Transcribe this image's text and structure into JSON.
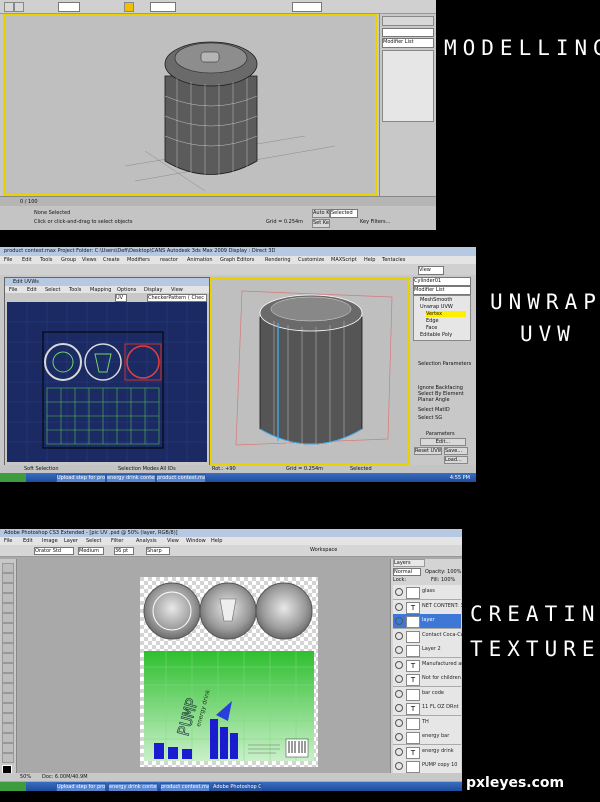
{
  "captions": {
    "modelling": "MODELLING",
    "unwrap_line1": "UNWRAP",
    "unwrap_line2": "UVW",
    "creating_line1": "CREATING",
    "creating_line2": "TEXTURE"
  },
  "watermark": "pxleyes.com",
  "panel1": {
    "modifier_list": "Modifier List",
    "timeline": "0 / 100",
    "status_selected": "None Selected",
    "status_prompt": "Click or click-and-drag to select objects",
    "grid": "Grid = 0.254m",
    "auto_key": "Auto Key",
    "selected": "Selected",
    "set_key": "Set Key",
    "key_filters": "Key Filters...",
    "add_time_tag": "Add Time Tag"
  },
  "panel2": {
    "title": "product contest.max    Project Folder: C:\\Users\\Defi\\Desktop\\CANS    Autodesk 3ds Max 2009    Display : Direct 3D",
    "menu": [
      "File",
      "Edit",
      "Tools",
      "Group",
      "Views",
      "Create",
      "Modifiers",
      "reactor",
      "Animation",
      "Graph Editors",
      "Rendering",
      "Customize",
      "MAXScript",
      "Help",
      "Tentacles"
    ],
    "edit_uvw_title": "Edit UVWs",
    "edit_uvw_menu": [
      "File",
      "Edit",
      "Select",
      "Tools",
      "Mapping",
      "Options",
      "Display",
      "View"
    ],
    "uv_dropdown": "UV",
    "pattern_dropdown": "CheckerPattern ( Chec",
    "modifier_list": "Modifier List",
    "object_name": "Cylinder01",
    "stack": [
      "MeshSmooth",
      "Unwrap UVW",
      "Vertex",
      "Edge",
      "Face",
      "Editable Poly"
    ],
    "selection_params": "Selection Parameters",
    "ignore_backfacing": "Ignore Backfacing",
    "select_by_element": "Select By Element",
    "planar_angle": "Planar Angle",
    "select_mat_id": "Select MatID",
    "select_sg": "Select SG",
    "parameters": "Parameters",
    "edit": "Edit...",
    "reset_uvws": "Reset UVWs",
    "save": "Save...",
    "load": "Load...",
    "channel": "Channel:",
    "map_channel": "Map Channel:",
    "soft_selection": "Soft Selection",
    "selection_modes": "Selection Modes",
    "all_ids": "All IDs",
    "rot": "Rot.: +90",
    "grid": "Grid = 0.254m",
    "selected": "Selected",
    "add_time_tag": "Add Time Tag",
    "clock": "4:55 PM"
  },
  "panel3": {
    "title": "Adobe Photoshop CS3 Extended - [pic UV .psd @ 50% (layer, RGB/8)]",
    "menu": [
      "File",
      "Edit",
      "Image",
      "Layer",
      "Select",
      "Filter",
      "Analysis",
      "View",
      "Window",
      "Help"
    ],
    "font": "Orator Std",
    "style": "Medium",
    "size": "36 pt",
    "aa": "Sharp",
    "workspace": "Workspace",
    "layers_title": "Layers",
    "blend": "Normal",
    "opacity": "Opacity: 100%",
    "fill": "Fill: 100%",
    "lock": "Lock:",
    "layers": [
      {
        "name": "glass",
        "type": "img"
      },
      {
        "name": "NET CONTENT: 33...",
        "type": "T"
      },
      {
        "name": "layer",
        "type": "img"
      },
      {
        "name": "Contact Coca-Cola...",
        "type": "img"
      },
      {
        "name": "Layer 2",
        "type": "img"
      },
      {
        "name": "Manufactured and ...",
        "type": "T"
      },
      {
        "name": "Not for children (this...",
        "type": "T"
      },
      {
        "name": "bar code",
        "type": "img"
      },
      {
        "name": "11 FL OZ        DRnt",
        "type": "T"
      },
      {
        "name": "TH",
        "type": "img"
      },
      {
        "name": "energy bar",
        "type": "img"
      },
      {
        "name": "energy drink",
        "type": "T"
      },
      {
        "name": "PUMP copy 10",
        "type": "img"
      }
    ],
    "can_brand": "PUMP",
    "can_sub": "energy drink",
    "doc_size": "Doc: 6.00M/40.9M",
    "zoom": "50%"
  },
  "taskbar2": [
    "Upload step for prod...",
    "energy drink contest...",
    "product contest.max..."
  ],
  "taskbar3": [
    "Upload step for prod...",
    "energy drink contest...",
    "product contest.max...",
    "Adobe Photoshop C..."
  ],
  "colors": {
    "viewport_bg": "#bfbfbf",
    "uv_blue": "#1b2a63",
    "selection_yellow": "#ffee00",
    "rollout_bg": "#c8c8c8",
    "label_green": "#2ba52b",
    "ps_bg": "#a9a9a9"
  }
}
